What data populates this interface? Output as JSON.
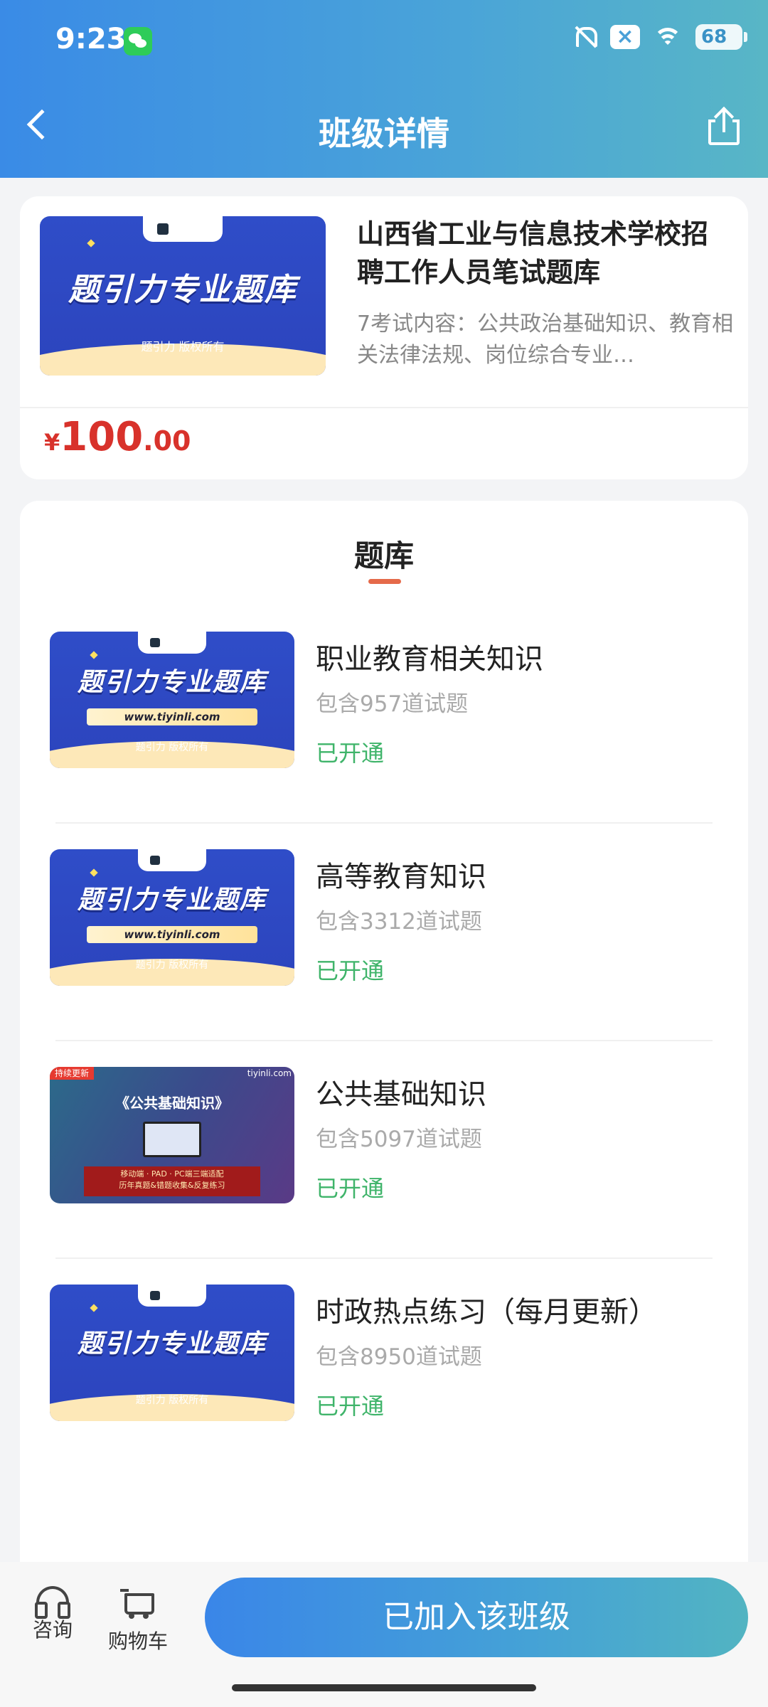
{
  "status_bar": {
    "time": "9:23",
    "battery": "68"
  },
  "header": {
    "title": "班级详情"
  },
  "class_card": {
    "cover": {
      "brand": "题引力专业题库",
      "copyright": "题引力 版权所有"
    },
    "title": "山西省工业与信息技术学校招聘工作人员笔试题库",
    "description": "7考试内容：公共政治基础知识、教育相关法律法规、岗位综合专业…",
    "price": {
      "currency": "¥",
      "integer": "100",
      "decimal": ".00"
    }
  },
  "section": {
    "title": "题库"
  },
  "banks": [
    {
      "name": "职业教育相关知识",
      "count": "包含957道试题",
      "status": "已开通",
      "cover": {
        "brand": "题引力专业题库",
        "url": "www.tiyinli.com",
        "copyright": "题引力 版权所有"
      }
    },
    {
      "name": "高等教育知识",
      "count": "包含3312道试题",
      "status": "已开通",
      "cover": {
        "brand": "题引力专业题库",
        "url": "www.tiyinli.com",
        "copyright": "题引力 版权所有"
      }
    },
    {
      "name": "公共基础知识",
      "count": "包含5097道试题",
      "status": "已开通",
      "cover": {
        "badge": "持续更新",
        "logo": "tiyinli.com",
        "title": "《公共基础知识》",
        "banner_line1": "移动端 · PAD · PC端三端适配",
        "banner_line2": "历年真题&错题收集&反复练习"
      }
    },
    {
      "name": "时政热点练习（每月更新）",
      "count": "包含8950道试题",
      "status": "已开通",
      "cover": {
        "brand": "题引力专业题库",
        "copyright": "题引力 版权所有"
      }
    }
  ],
  "bottom_bar": {
    "consult_label": "咨询",
    "cart_label": "购物车",
    "join_button": "已加入该班级"
  },
  "colors": {
    "accent": "#3a8be6",
    "price": "#d8322b",
    "status_green": "#3fb46a"
  }
}
